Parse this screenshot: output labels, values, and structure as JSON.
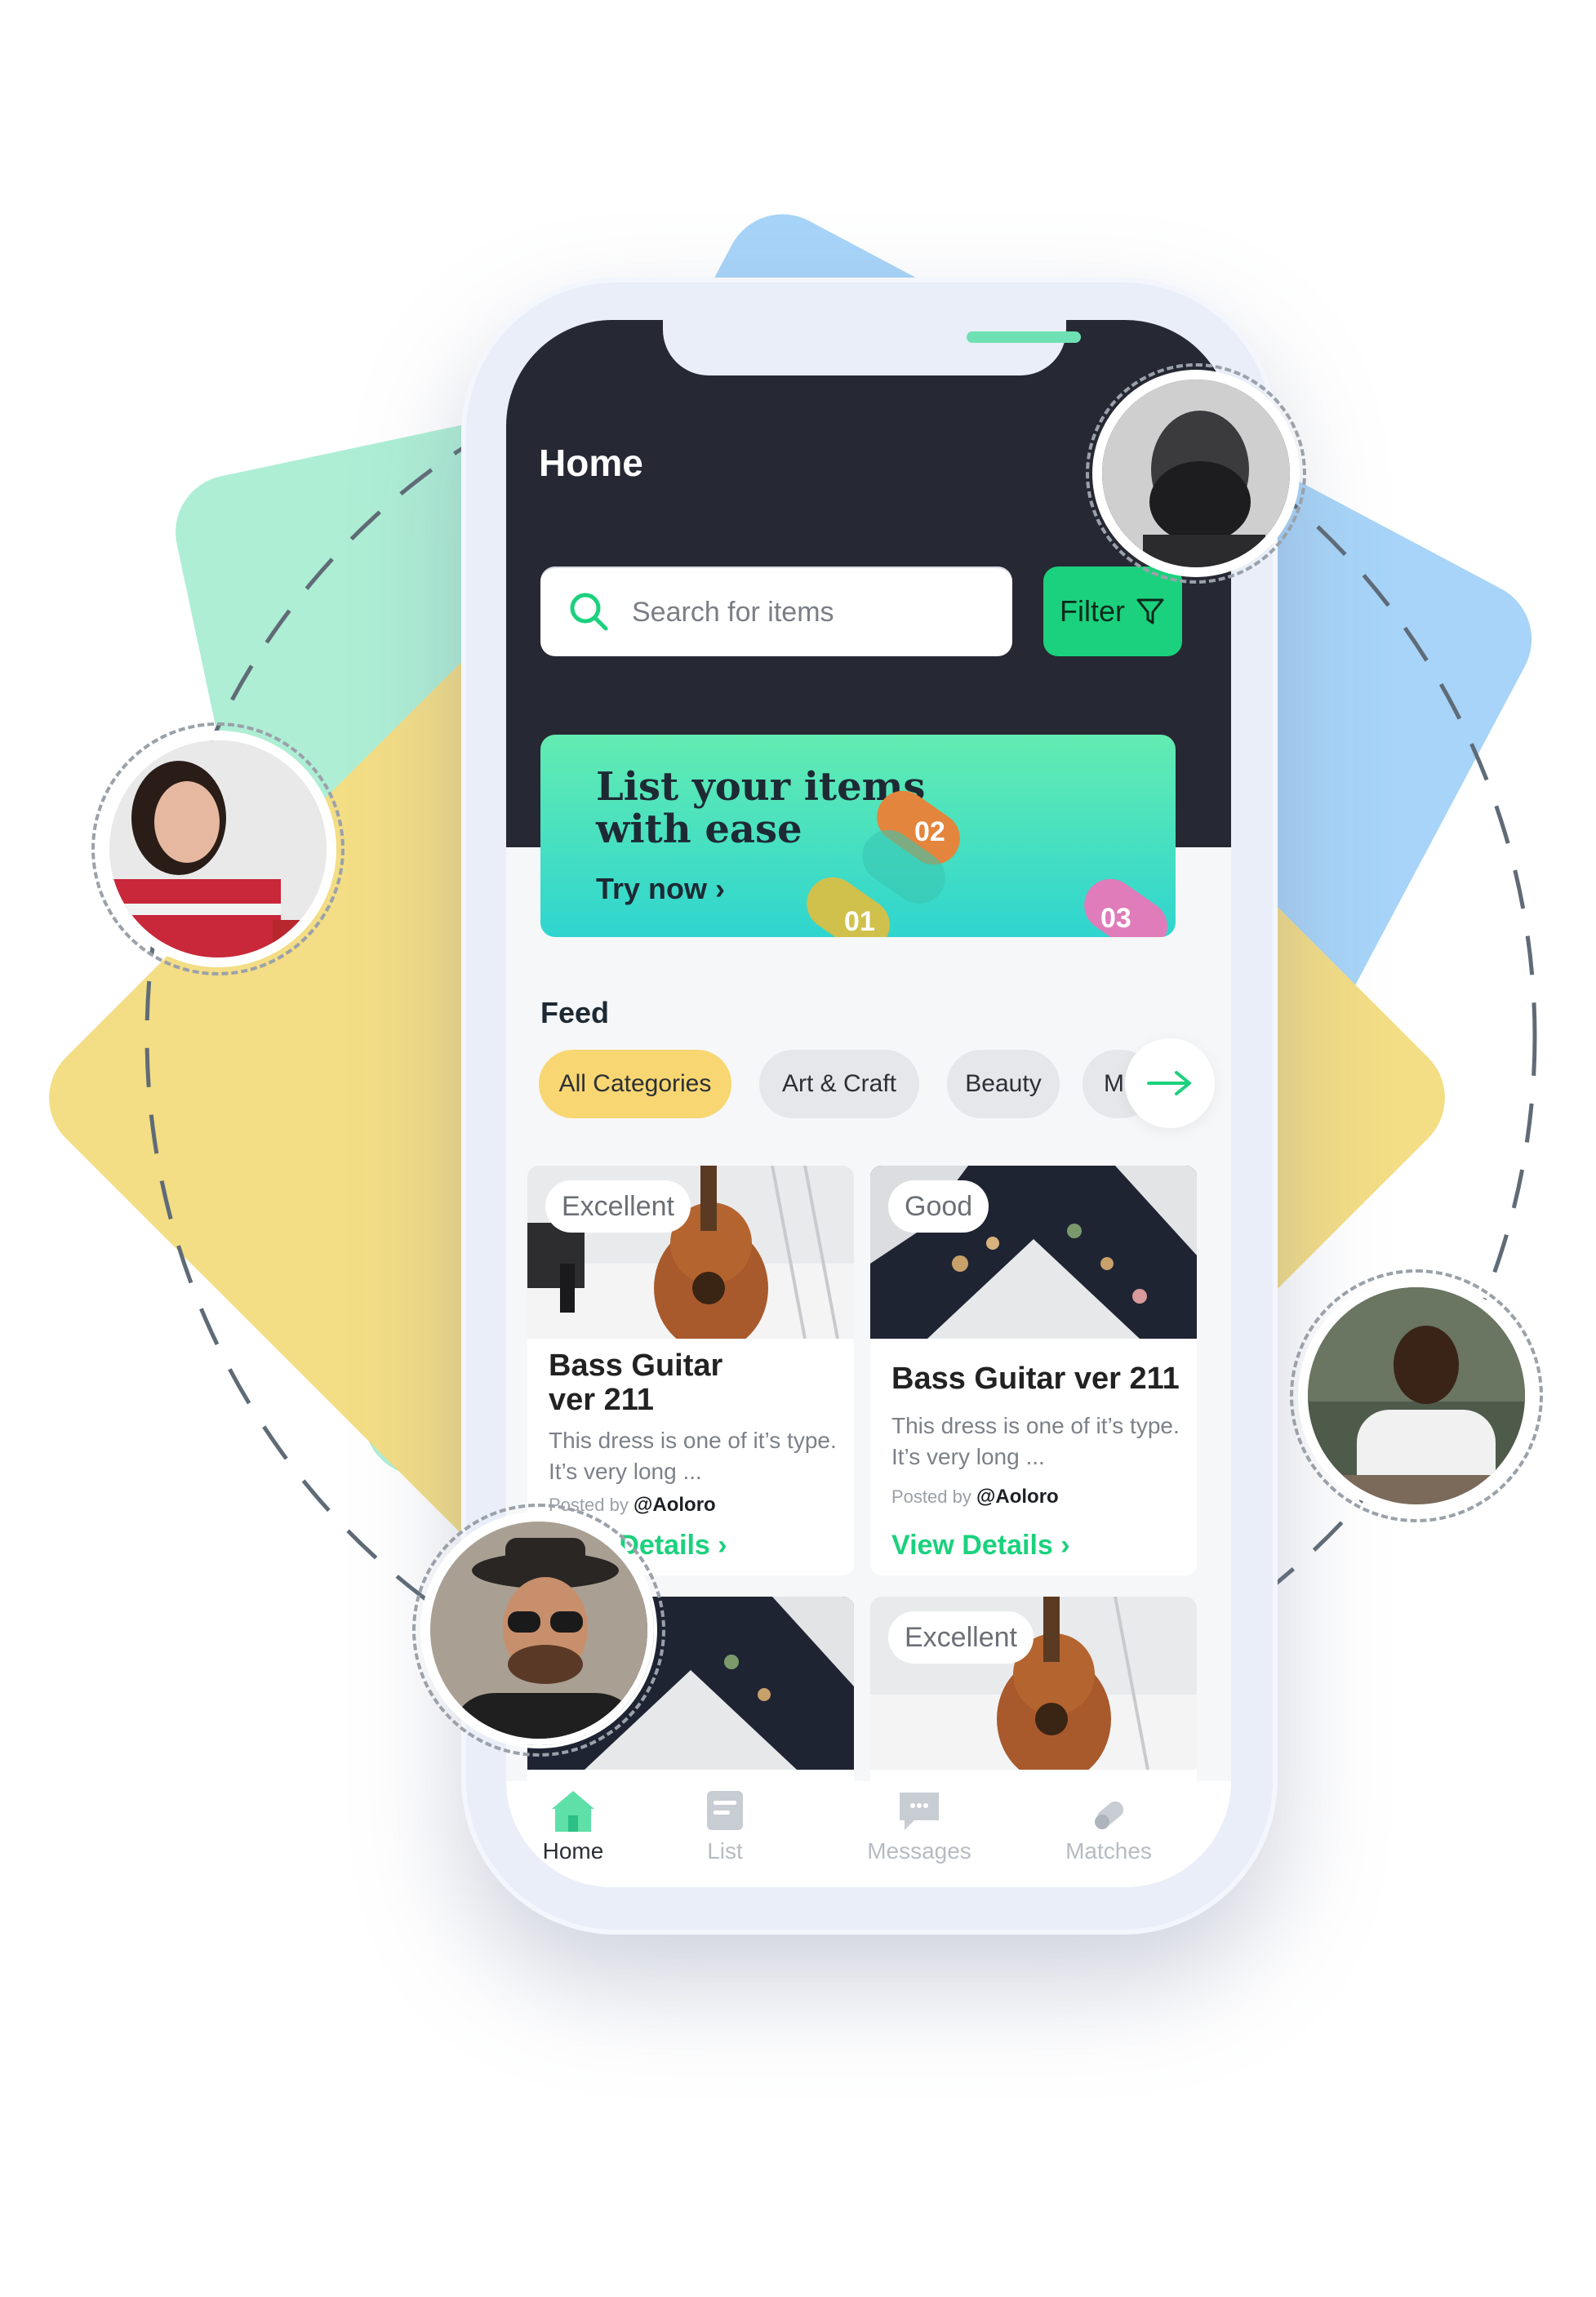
{
  "colors": {
    "accent_green": "#1bd17d",
    "dark_header": "#262833",
    "chip_active": "#f8d772",
    "card_green": "#9ee8c8",
    "card_yellow": "#f3dd85",
    "card_blue": "#a7d4f8"
  },
  "header": {
    "title": "Home"
  },
  "search": {
    "placeholder": "Search for items",
    "icon": "search-icon"
  },
  "filter": {
    "label": "Filter",
    "icon": "filter-icon"
  },
  "banner": {
    "title_line1": "List your items",
    "title_line2": "with ease",
    "cta": "Try now",
    "steps": [
      "01",
      "02",
      "03"
    ]
  },
  "feed": {
    "label": "Feed",
    "categories": [
      "All Categories",
      "Art & Craft",
      "Beauty",
      "Mu"
    ],
    "active_category": "All Categories"
  },
  "items": [
    {
      "condition": "Excellent",
      "name_line1": "Bass Guitar",
      "name_line2": "ver 211",
      "desc_line1": "This dress is one of it’s type.",
      "desc_line2": "It’s very long ...",
      "posted_prefix": "Posted by",
      "posted_user": "@Aoloro",
      "cta": "View Details"
    },
    {
      "condition": "Good",
      "name_line1": "Bass Guitar ver 211",
      "desc_line1": "This dress is one of it’s type.",
      "desc_line2": "It’s very long ...",
      "posted_prefix": "Posted by",
      "posted_user": "@Aoloro",
      "cta": "View Details"
    },
    {
      "condition": ""
    },
    {
      "condition": "Excellent"
    }
  ],
  "tabs": [
    {
      "label": "Home",
      "icon": "home-icon",
      "active": true
    },
    {
      "label": "List",
      "icon": "list-icon",
      "active": false
    },
    {
      "label": "Messages",
      "icon": "messages-icon",
      "active": false
    },
    {
      "label": "Matches",
      "icon": "matches-icon",
      "active": false
    }
  ]
}
